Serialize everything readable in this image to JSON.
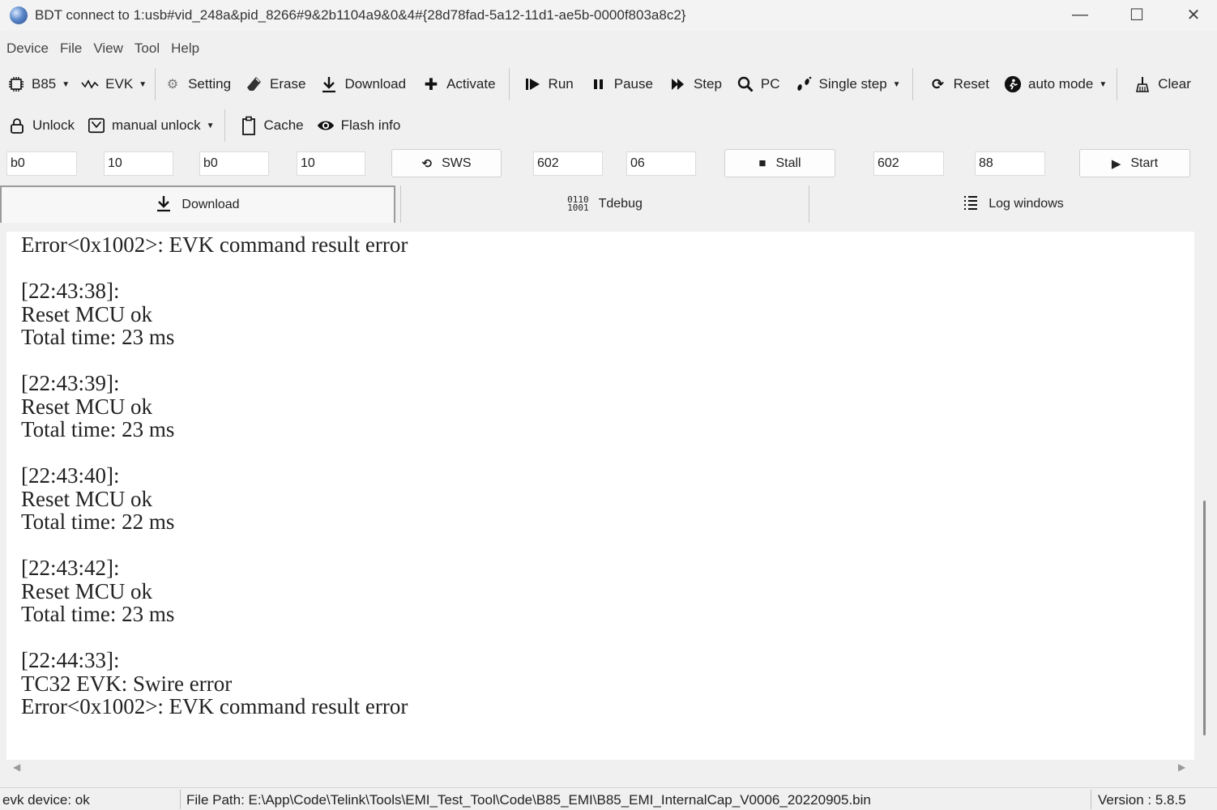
{
  "window": {
    "title": "BDT connect to 1:usb#vid_248a&pid_8266#9&2b1104a9&0&4#{28d78fad-5a12-11d1-ae5b-0000f803a8c2}",
    "minimize": "—",
    "maximize": "☐",
    "close": "✕"
  },
  "menu": [
    "Device",
    "File",
    "View",
    "Tool",
    "Help"
  ],
  "toolbar1": {
    "chip": "B85",
    "evk": "EVK",
    "setting": "Setting",
    "erase": "Erase",
    "download": "Download",
    "activate": "Activate",
    "run": "Run",
    "pause": "Pause",
    "step": "Step",
    "pc": "PC",
    "single_step": "Single step",
    "reset": "Reset",
    "auto_mode": "auto mode",
    "clear": "Clear"
  },
  "toolbar2": {
    "unlock": "Unlock",
    "manual_unlock": "manual unlock",
    "cache": "Cache",
    "flash_info": "Flash info"
  },
  "fields": {
    "f1": "b0",
    "f2": "10",
    "f3": "b0",
    "f4": "10",
    "sws_label": "SWS",
    "f5": "602",
    "f6": "06",
    "stall_label": "Stall",
    "f7": "602",
    "f8": "88",
    "start_label": "Start"
  },
  "tabs": {
    "download": "Download",
    "tdebug": "Tdebug",
    "log_windows": "Log windows"
  },
  "log": {
    "text": "Error<0x1002>: EVK command result error\n\n[22:43:38]:\nReset MCU ok\nTotal time: 23 ms\n\n[22:43:39]:\nReset MCU ok\nTotal time: 23 ms\n\n[22:43:40]:\nReset MCU ok\nTotal time: 22 ms\n\n[22:43:42]:\nReset MCU ok\nTotal time: 23 ms\n\n[22:44:33]:\nTC32 EVK: Swire error\nError<0x1002>: EVK command result error"
  },
  "status": {
    "device": "evk device: ok",
    "file_path": "File Path:  E:\\App\\Code\\Telink\\Tools\\EMI_Test_Tool\\Code\\B85_EMI\\B85_EMI_InternalCap_V0006_20220905.bin",
    "version": "Version : 5.8.5"
  },
  "icons": {
    "chip": "chip-icon",
    "evk": "evk-wave-icon",
    "setting": "gear-icon",
    "erase": "eraser-icon",
    "download": "download-arrow-icon",
    "activate": "plus-icon",
    "run": "run-icon",
    "pause": "pause-icon",
    "step": "step-icon",
    "pc": "search-icon",
    "single_step": "footsteps-icon",
    "reset": "reset-icon",
    "auto_mode": "auto-mode-icon",
    "clear": "broom-icon",
    "unlock": "lock-icon",
    "manual_unlock": "mail-icon",
    "cache": "clipboard-icon",
    "flash_info": "eye-icon"
  }
}
